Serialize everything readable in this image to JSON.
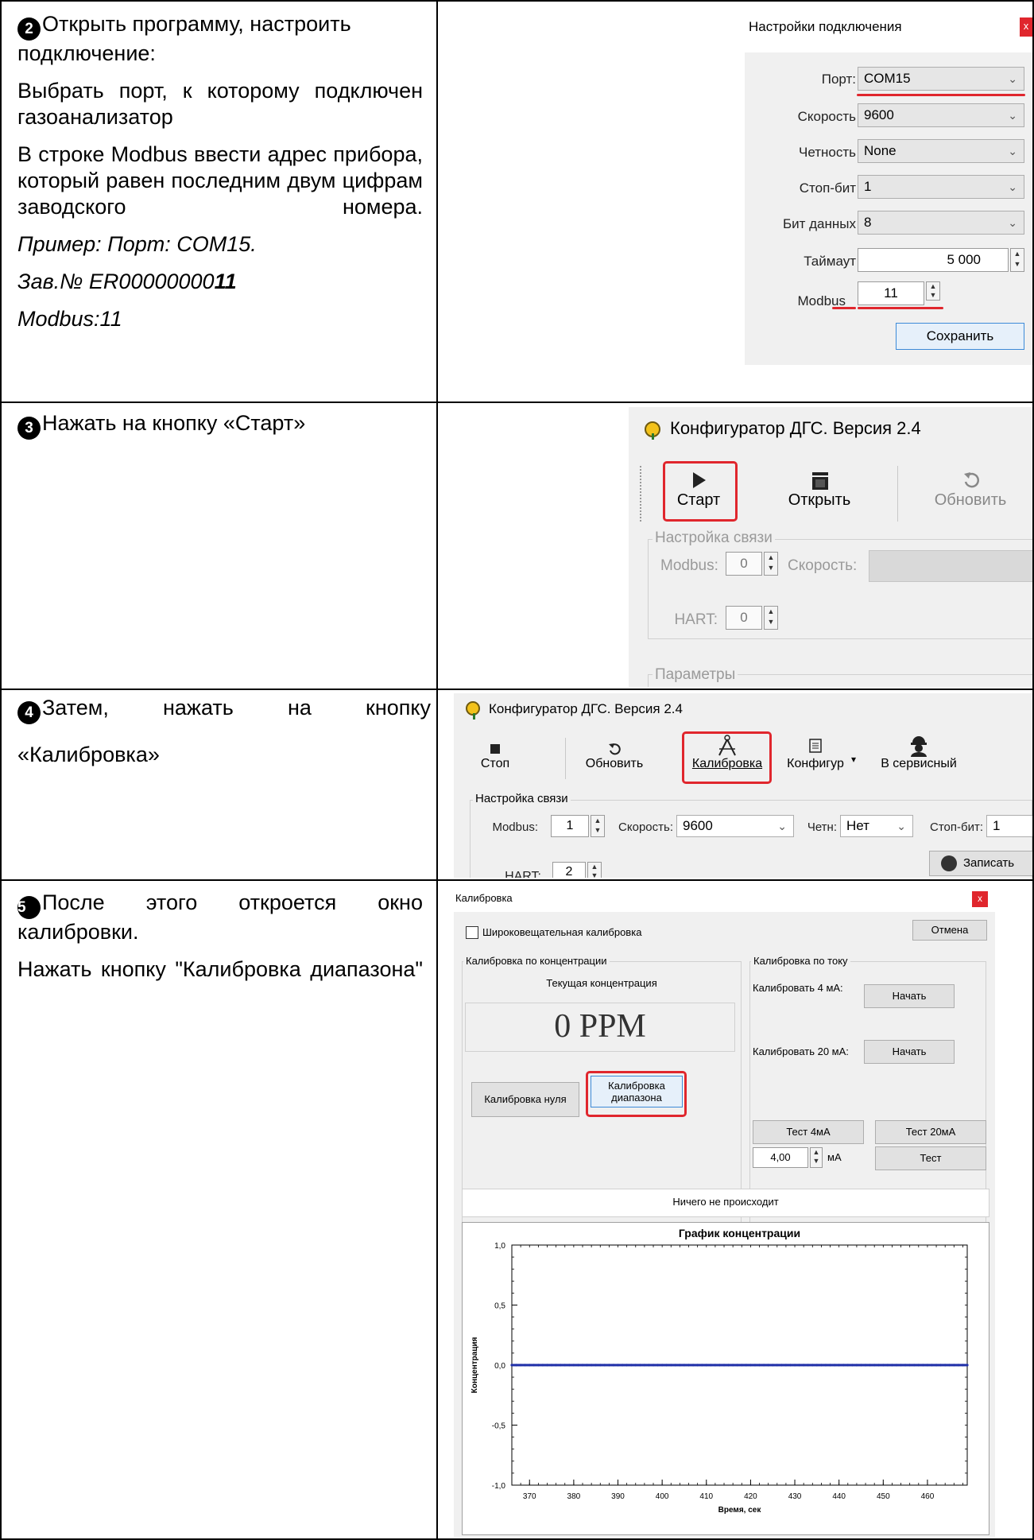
{
  "rows": [
    {
      "num": "2",
      "p1": "Открыть программу, настроить подключение:",
      "p2": "Выбрать порт, к которому подключен газоанализатор",
      "p3": "В строке Modbus ввести адрес прибора, который равен последним двум цифрам заводского номера.",
      "ex1": "Пример:  Порт: COM15.",
      "ex2_prefix": "Зав.№ ER00000000",
      "ex2_bold": "11",
      "ex3": "Modbus:11"
    },
    {
      "num": "3",
      "p1": "Нажать на кнопку «Старт»"
    },
    {
      "num": "4",
      "p1a": "Затем,",
      "p1b": "нажать",
      "p1c": "на",
      "p1d": "кнопку",
      "p2": "«Калибровка»"
    },
    {
      "num": "5",
      "p1": "После этого откроется окно калибровки.",
      "p2": "Нажать кнопку \"Калибровка диапазона\""
    }
  ],
  "conn_settings": {
    "title": "Настройки подключения",
    "close": "x",
    "port_label": "Порт:",
    "port_value": "COM15",
    "speed_label": "Скорость",
    "speed_value": "9600",
    "parity_label": "Четность",
    "parity_value": "None",
    "stopbit_label": "Стоп-бит",
    "stopbit_value": "1",
    "databits_label": "Бит данных",
    "databits_value": "8",
    "timeout_label": "Таймаут",
    "timeout_value": "5 000",
    "modbus_label": "Modbus",
    "modbus_value": "11",
    "save_label": "Сохранить"
  },
  "configurator1": {
    "title": "Конфигуратор ДГС. Версия 2.4",
    "start_label": "Старт",
    "open_label": "Открыть",
    "refresh_label": "Обновить",
    "link_group": "Настройка связи",
    "modbus_label": "Modbus:",
    "modbus_value": "0",
    "speed_label": "Скорость:",
    "hart_label": "HART:",
    "hart_value": "0",
    "params_group": "Параметры"
  },
  "configurator2": {
    "title": "Конфигуратор ДГС. Версия 2.4",
    "stop_label": "Стоп",
    "refresh_label": "Обновить",
    "calib_label": "Калибровка",
    "config_label": "Конфигур",
    "service_label": "В сервисный",
    "link_group": "Настройка связи",
    "modbus_label": "Modbus:",
    "modbus_value": "1",
    "speed_label": "Скорость:",
    "speed_value": "9600",
    "parity_label": "Четн:",
    "parity_value": "Нет",
    "stopbit_label": "Стоп-бит:",
    "stopbit_value": "1",
    "hart_label": "HART:",
    "hart_value": "2",
    "write_label": "Записать"
  },
  "calibration": {
    "title": "Калибровка",
    "close": "x",
    "broadband_label": "Широковещательная калибровка",
    "cancel_label": "Отмена",
    "conc_group": "Калибровка по концентрации",
    "current_conc_label": "Текущая концентрация",
    "conc_value": "0  PPM",
    "zero_label": "Калибровка нуля",
    "range_label_1": "Калибровка",
    "range_label_2": "диапазона",
    "current_group": "Калибровка по току",
    "cal4_label": "Калибровать 4 мА:",
    "start_label": "Начать",
    "cal20_label": "Калибровать 20 мА:",
    "test4_label": "Тест 4мА",
    "test20_label": "Тест 20мА",
    "ma_value": "4,00",
    "ma_unit": "мА",
    "test_label": "Тест",
    "status_text": "Ничего не происходит"
  },
  "chart_data": {
    "type": "line",
    "title": "График концентрации",
    "xlabel": "Время, сек",
    "ylabel": "Концентрация",
    "xlim": [
      366,
      469
    ],
    "ylim": [
      -1.0,
      1.0
    ],
    "x_ticks": [
      370,
      380,
      390,
      400,
      410,
      420,
      430,
      440,
      450,
      460
    ],
    "y_ticks": [
      1.0,
      0.5,
      0.0,
      -0.5,
      -1.0
    ],
    "y_tick_labels": [
      "1,0",
      "0,5",
      "0,0",
      "-0,5",
      "-1,0"
    ],
    "series": [
      {
        "color": "#1f2fa8",
        "x": [
          366,
          469
        ],
        "y": [
          0.0,
          0.0
        ]
      }
    ]
  }
}
